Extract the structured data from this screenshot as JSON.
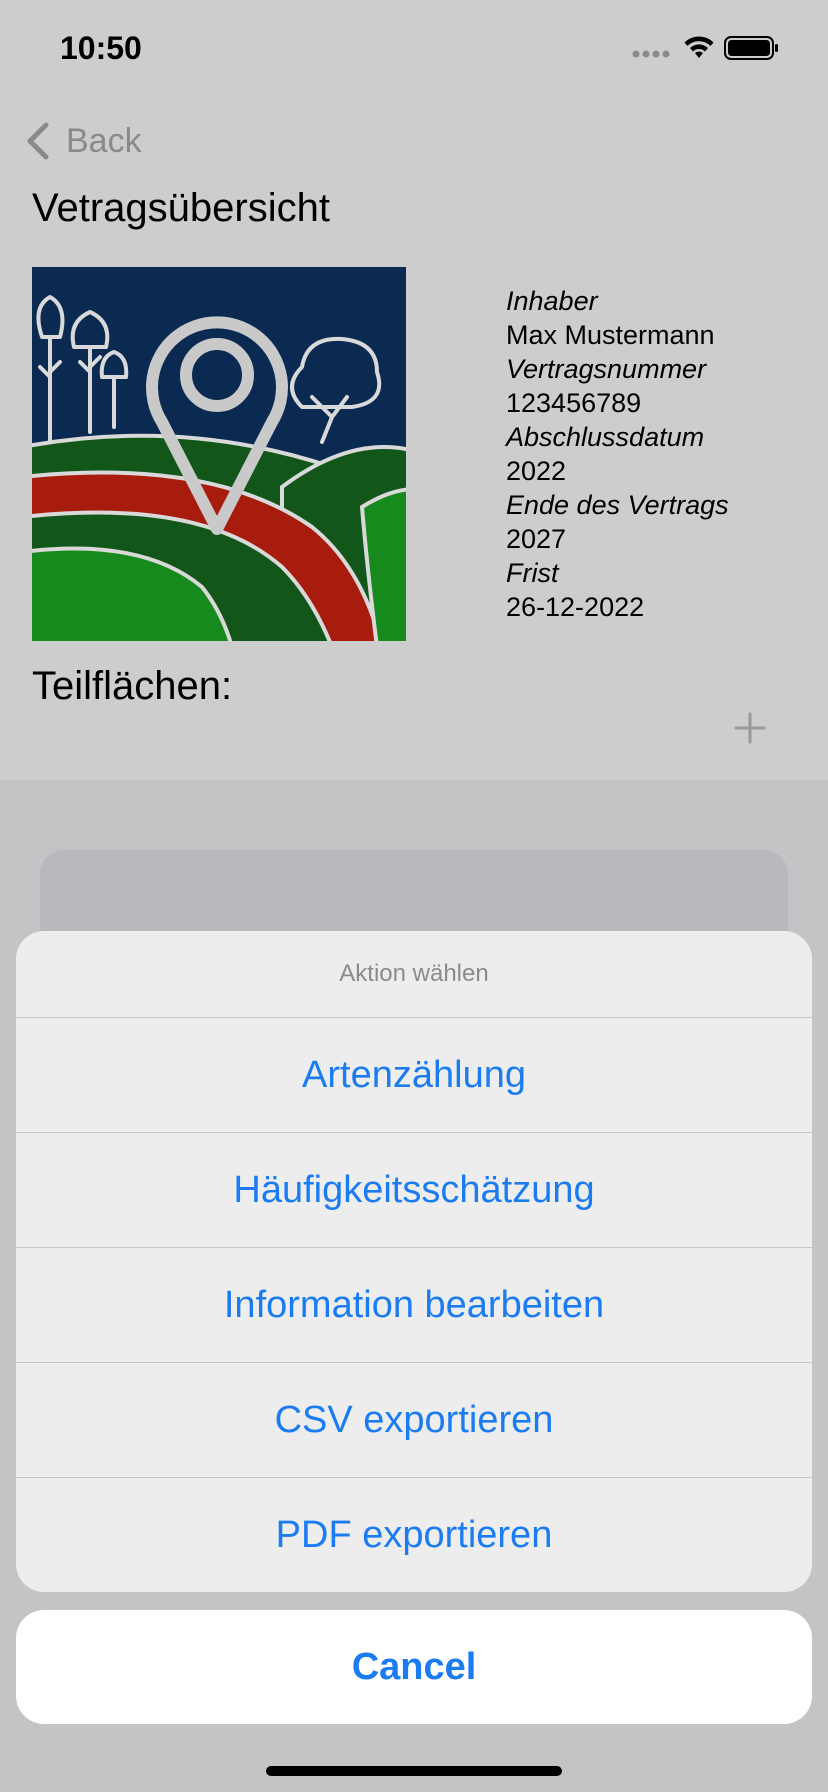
{
  "status_bar": {
    "time": "10:50"
  },
  "nav": {
    "back_label": "Back"
  },
  "page": {
    "title": "Vetragsübersicht",
    "info": [
      {
        "label": "Inhaber",
        "value": "Max Mustermann"
      },
      {
        "label": "Vertragsnummer",
        "value": "123456789"
      },
      {
        "label": "Abschlussdatum",
        "value": "2022"
      },
      {
        "label": "Ende des Vertrags",
        "value": "2027"
      },
      {
        "label": "Frist",
        "value": "26-12-2022"
      }
    ],
    "section_title": "Teilflächen:"
  },
  "action_sheet": {
    "title": "Aktion wählen",
    "items": [
      {
        "label": "Artenzählung"
      },
      {
        "label": "Häufigkeitsschätzung"
      },
      {
        "label": "Information bearbeiten"
      },
      {
        "label": "CSV exportieren"
      },
      {
        "label": "PDF exportieren"
      }
    ],
    "cancel_label": "Cancel"
  },
  "icons": {
    "back": "chevron-left-icon",
    "add": "plus-icon",
    "signal": "cellular-signal-icon",
    "wifi": "wifi-icon",
    "battery": "battery-icon"
  },
  "colors": {
    "accent": "#1b7cf2",
    "image_sky": "#0b2a52",
    "image_field_dark": "#12561a",
    "image_field_red": "#a81c0e",
    "image_field_green": "#168a1c"
  }
}
